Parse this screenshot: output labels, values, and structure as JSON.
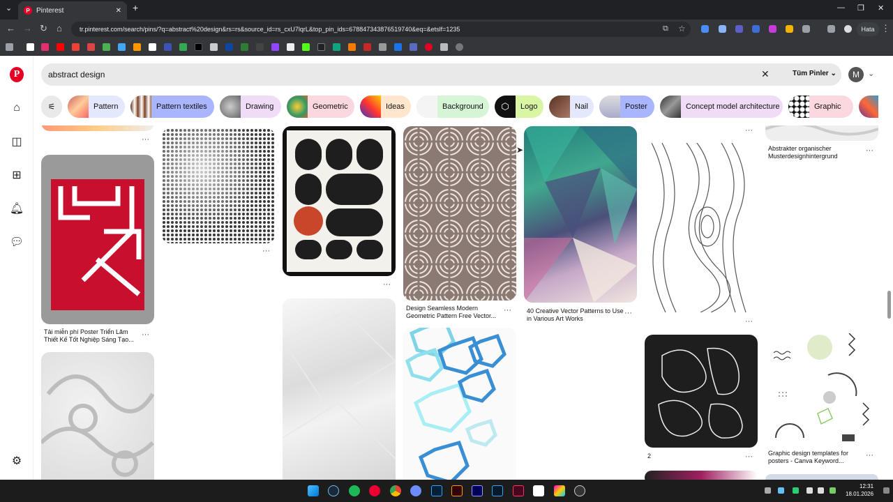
{
  "browser": {
    "tab_title": "Pinterest",
    "url": "tr.pinterest.com/search/pins/?q=abstract%20design&rs=rs&source_id=rs_cxU7lqrL&top_pin_ids=678847343876519740&eq=&etslf=1235",
    "profile_label": "Hata"
  },
  "search": {
    "query": "abstract design",
    "filter_label": "Tüm Pinler",
    "avatar_letter": "M"
  },
  "chips": [
    {
      "label": "Pattern",
      "color": "#e3e8ff"
    },
    {
      "label": "Pattern textiles",
      "color": "#a9b5ff"
    },
    {
      "label": "Drawing",
      "color": "#f0dcf7"
    },
    {
      "label": "Geometric",
      "color": "#fbd8df"
    },
    {
      "label": "Ideas",
      "color": "#ffe6cc"
    },
    {
      "label": "Background",
      "color": "#d6f5d6"
    },
    {
      "label": "Logo",
      "color": "#d9f6a4"
    },
    {
      "label": "Nail",
      "color": "#e3e8ff"
    },
    {
      "label": "Poster",
      "color": "#a9b5ff"
    },
    {
      "label": "Concept model architecture",
      "color": "#f0dcf7"
    },
    {
      "label": "Graphic",
      "color": "#fbd8df"
    }
  ],
  "pins": {
    "poster_caption": "Tải miễn phí Poster Triển Lãm Thiết Kế Tốt Nghiệp Sáng Tạo...",
    "geometric_caption": "Design Seamless Modern Geometric Pattern Free Vector...",
    "vector_caption": "40 Creative Vector Patterns to Use in Various Art Works",
    "organic_caption": "Abstrakter organischer Musterdesignhintergrund",
    "canva_caption": "Graphic design templates for posters - Canva Keyword...",
    "count_caption": "2"
  },
  "taskbar": {
    "time": "12:31",
    "date": "18.01.2026"
  },
  "colors": {
    "brand": "#e60023"
  }
}
